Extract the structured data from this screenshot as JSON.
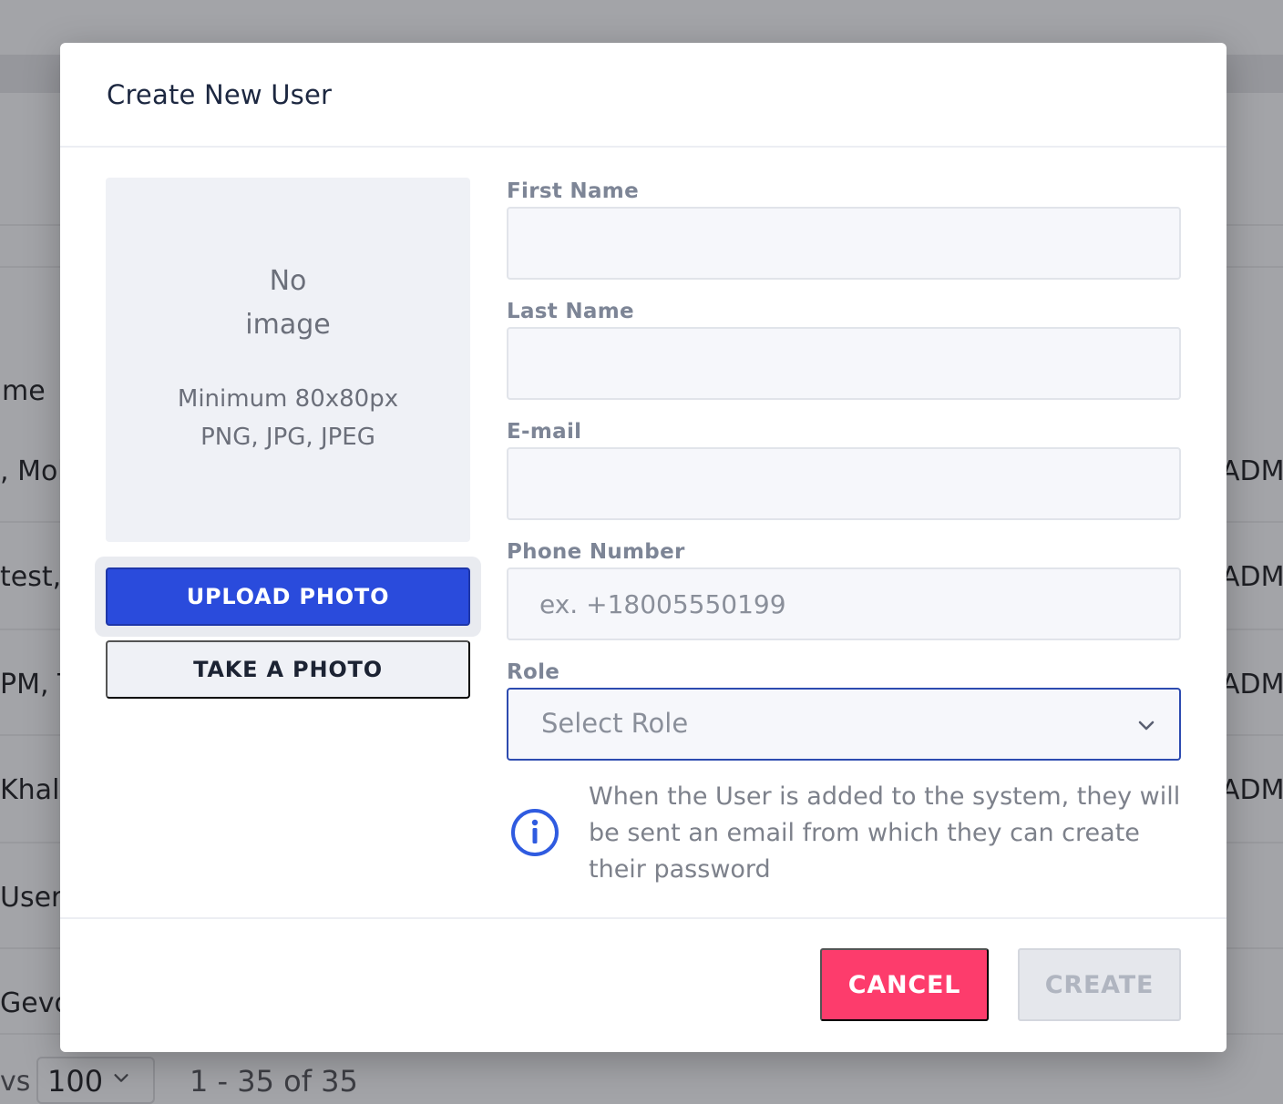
{
  "background": {
    "column_header": "me",
    "rows": [
      ", Mob",
      "test, ",
      "PM, T",
      "Khala",
      "User,",
      "Gevo"
    ],
    "role_cells": [
      "ADM.",
      "ADM.",
      "ADM.",
      "ADM."
    ],
    "rows_label": "vs",
    "rows_per_page": "100",
    "range": "1 - 35 of 35"
  },
  "modal": {
    "title": "Create New User",
    "photo": {
      "no_image_line1": "No",
      "no_image_line2": "image",
      "requirement_line1": "Minimum 80x80px",
      "requirement_line2": "PNG, JPG, JPEG",
      "upload_label": "UPLOAD PHOTO",
      "take_label": "TAKE A PHOTO"
    },
    "form": {
      "first_name_label": "First Name",
      "first_name_value": "",
      "last_name_label": "Last Name",
      "last_name_value": "",
      "email_label": "E-mail",
      "email_value": "",
      "phone_label": "Phone Number",
      "phone_placeholder": "ex. +18005550199",
      "role_label": "Role",
      "role_placeholder": "Select Role"
    },
    "info_text": "When the User is added to the system, they will be sent an email from which they can create their password",
    "buttons": {
      "cancel": "CANCEL",
      "create": "CREATE"
    },
    "colors": {
      "primary": "#2a4bdc",
      "cancel": "#fd3c6c",
      "disabled": "#e5e7ec",
      "info_icon": "#2f5be0"
    }
  }
}
